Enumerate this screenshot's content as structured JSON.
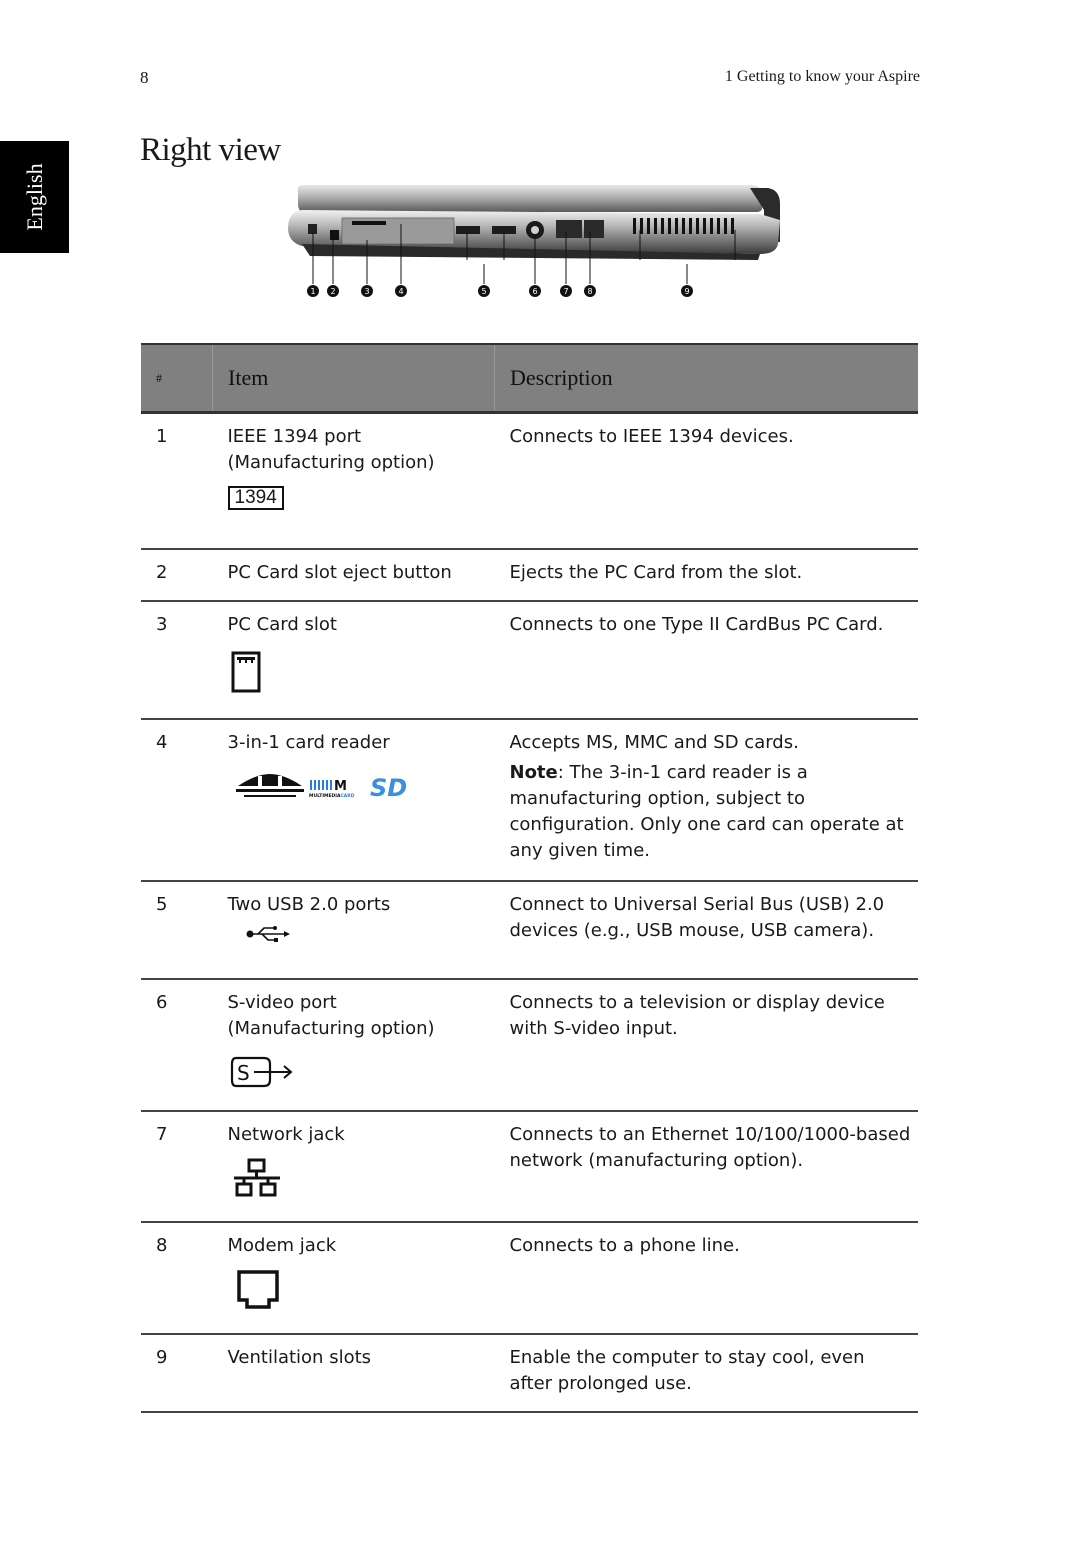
{
  "header": {
    "page_number": "8",
    "running_head": "1 Getting to know your Aspire",
    "language_tab": "English"
  },
  "section": {
    "title": "Right view"
  },
  "figure": {
    "description": "Right side view of the notebook with numbered callouts",
    "callouts": [
      "1",
      "2",
      "3",
      "4",
      "5",
      "6",
      "7",
      "8",
      "9"
    ]
  },
  "table": {
    "columns": [
      "#",
      "Item",
      "Description"
    ],
    "rows": [
      {
        "num": "1",
        "item_lines": [
          "IEEE 1394 port",
          "(Manufacturing option)"
        ],
        "icon": "ieee1394-icon",
        "icon_text": "1394",
        "description": [
          "Connects to IEEE 1394 devices."
        ]
      },
      {
        "num": "2",
        "item_lines": [
          "PC Card slot eject button"
        ],
        "icon": "",
        "description": [
          "Ejects the PC Card from the slot."
        ]
      },
      {
        "num": "3",
        "item_lines": [
          "PC Card slot"
        ],
        "icon": "pc-card-icon",
        "description": [
          "Connects to one Type II CardBus PC Card."
        ]
      },
      {
        "num": "4",
        "item_lines": [
          "3-in-1 card reader"
        ],
        "icon": "card-reader-logos-icon",
        "icon_labels": [
          "MS",
          "MULTIMEDIACARD",
          "SD"
        ],
        "description": [
          "Accepts MS, MMC and SD cards."
        ],
        "note_label": "Note",
        "note_text": ": The 3-in-1 card reader is a manufacturing option, subject to configuration. Only one card can operate at any given time."
      },
      {
        "num": "5",
        "item_lines": [
          "Two USB 2.0 ports"
        ],
        "icon": "usb-icon",
        "description": [
          "Connect to Universal Serial Bus (USB) 2.0 devices (e.g., USB mouse, USB camera)."
        ]
      },
      {
        "num": "6",
        "item_lines": [
          "S-video port",
          "(Manufacturing option)"
        ],
        "icon": "s-video-icon",
        "description": [
          "Connects to a television or display device with S-video input."
        ]
      },
      {
        "num": "7",
        "item_lines": [
          "Network jack"
        ],
        "icon": "network-icon",
        "description": [
          "Connects to an Ethernet 10/100/1000-based network (manufacturing option)."
        ]
      },
      {
        "num": "8",
        "item_lines": [
          "Modem jack"
        ],
        "icon": "modem-icon",
        "description": [
          "Connects to a phone line."
        ]
      },
      {
        "num": "9",
        "item_lines": [
          "Ventilation slots"
        ],
        "icon": "",
        "description": [
          "Enable the computer to stay cool, even after prolonged use."
        ]
      }
    ]
  },
  "colors": {
    "header_row_bg": "#808080",
    "sd_logo_blue": "#3a8fde",
    "mmc_logo_blue": "#2a7fd4"
  }
}
